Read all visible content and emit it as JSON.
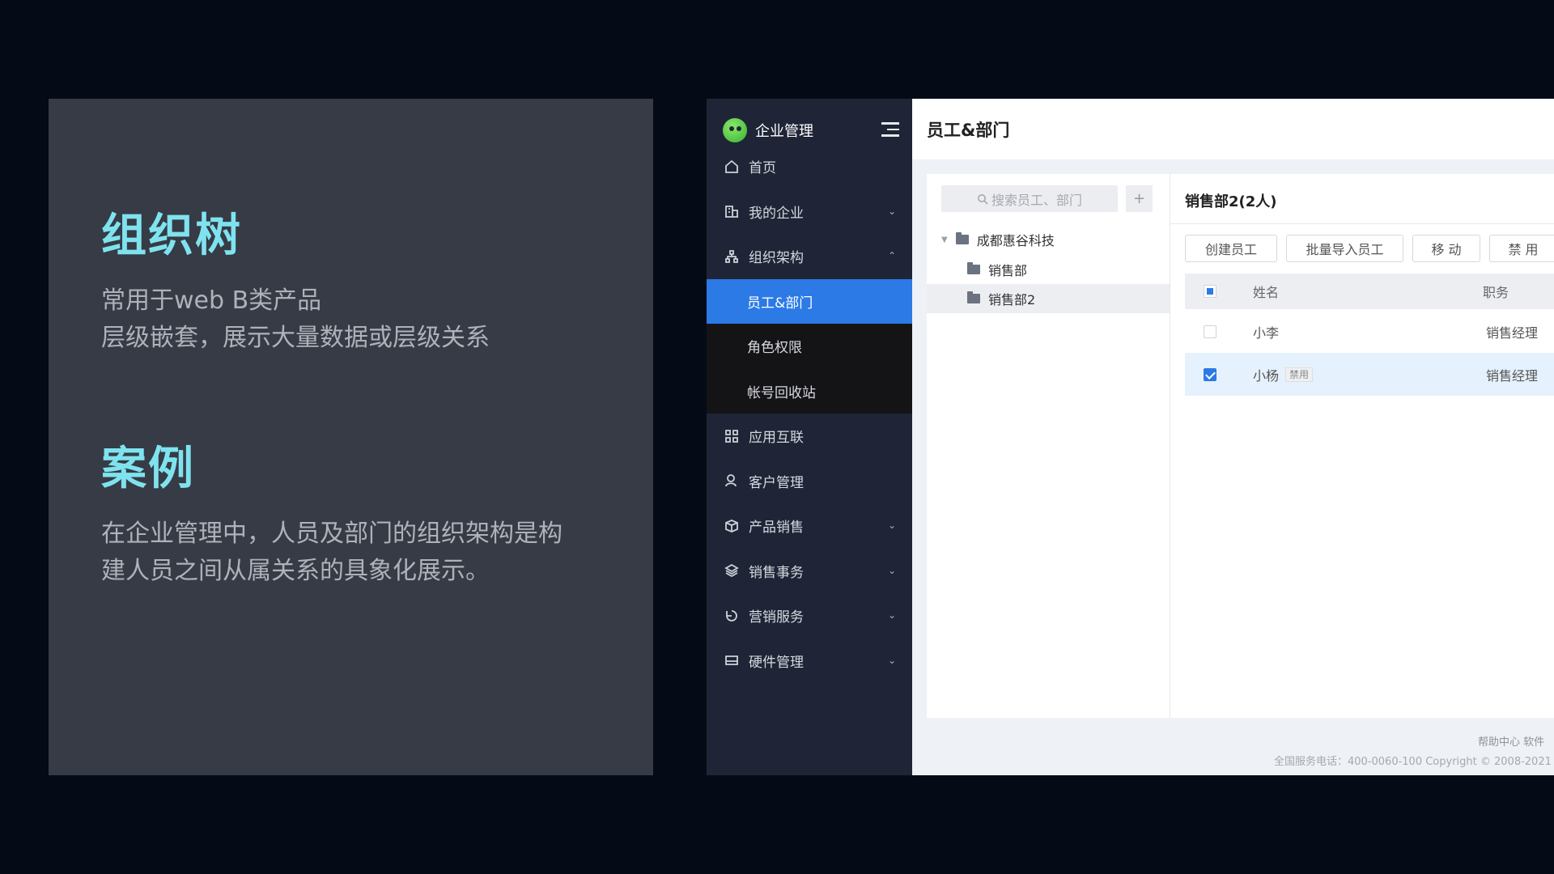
{
  "info": {
    "heading1": "组织树",
    "para1": [
      "常用于web B类产品",
      "层级嵌套，展示大量数据或层级关系"
    ],
    "heading2": "案例",
    "para2": [
      "在企业管理中，人员及部门的组织架构是构",
      "建人员之间从属关系的具象化展示。"
    ]
  },
  "app": {
    "brand": "企业管理",
    "menu": [
      {
        "label": "首页",
        "icon": "home-icon"
      },
      {
        "label": "我的企业",
        "icon": "building-icon",
        "chevron": "⌄"
      },
      {
        "label": "组织架构",
        "icon": "org-chart-icon",
        "chevron": "⌃"
      },
      {
        "label": "员工&部门",
        "active": true
      },
      {
        "label": "角色权限"
      },
      {
        "label": "帐号回收站"
      },
      {
        "label": "应用互联",
        "icon": "apps-icon"
      },
      {
        "label": "客户管理",
        "icon": "user-icon"
      },
      {
        "label": "产品销售",
        "icon": "box-icon",
        "chevron": "⌄"
      },
      {
        "label": "销售事务",
        "icon": "layers-icon",
        "chevron": "⌄"
      },
      {
        "label": "营销服务",
        "icon": "service-icon",
        "chevron": "⌄"
      },
      {
        "label": "硬件管理",
        "icon": "hardware-icon",
        "chevron": "⌄"
      }
    ],
    "page_title": "员工&部门",
    "search_placeholder": "搜索员工、部门",
    "add_label": "+",
    "tree": [
      {
        "label": "成都惠谷科技",
        "expanded": true
      },
      {
        "label": "销售部"
      },
      {
        "label": "销售部2",
        "selected": true
      }
    ],
    "dept_title": "销售部2(2人)",
    "actions": [
      "创建员工",
      "批量导入员工",
      "移 动",
      "禁 用"
    ],
    "table": {
      "headers": [
        "姓名",
        "职务"
      ],
      "rows": [
        {
          "name": "小李",
          "title": "销售经理",
          "checked": false,
          "tag": ""
        },
        {
          "name": "小杨",
          "title": "销售经理",
          "checked": true,
          "tag": "禁用"
        }
      ]
    },
    "footer": {
      "links": "帮助中心    软件",
      "copyright": "全国服务电话：400-0060-100 Copyright © 2008-2021"
    }
  },
  "colors": {
    "accent": "#2b7ae6",
    "heading": "#7fe3ef",
    "sidebar": "#1f2536"
  }
}
